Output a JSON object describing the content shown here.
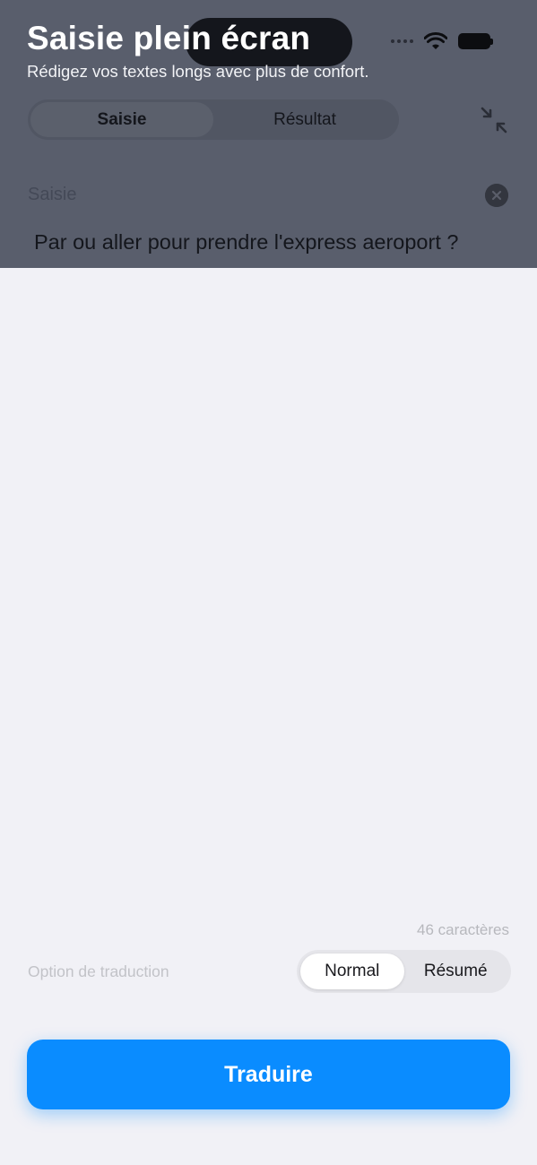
{
  "header": {
    "title": "Saisie plein écran",
    "subtitle": "Rédigez vos textes longs avec plus de confort."
  },
  "tabs": [
    {
      "label": "Saisie",
      "active": true
    },
    {
      "label": "Résultat",
      "active": false
    }
  ],
  "input": {
    "label": "Saisie",
    "value": "Par ou aller pour prendre l'express aeroport ?"
  },
  "footer": {
    "char_count": "46 caractères",
    "option_label": "Option de traduction",
    "modes": [
      {
        "label": "Normal",
        "active": true
      },
      {
        "label": "Résumé",
        "active": false
      }
    ],
    "translate_label": "Traduire"
  },
  "icons": {
    "collapse": "collapse-arrows-icon",
    "clear": "clear-icon",
    "wifi": "wifi-icon",
    "battery": "battery-icon",
    "signal": "signal-icon"
  },
  "colors": {
    "accent": "#0a8cff",
    "overlay": "#595e6c",
    "background": "#f1f1f6"
  }
}
